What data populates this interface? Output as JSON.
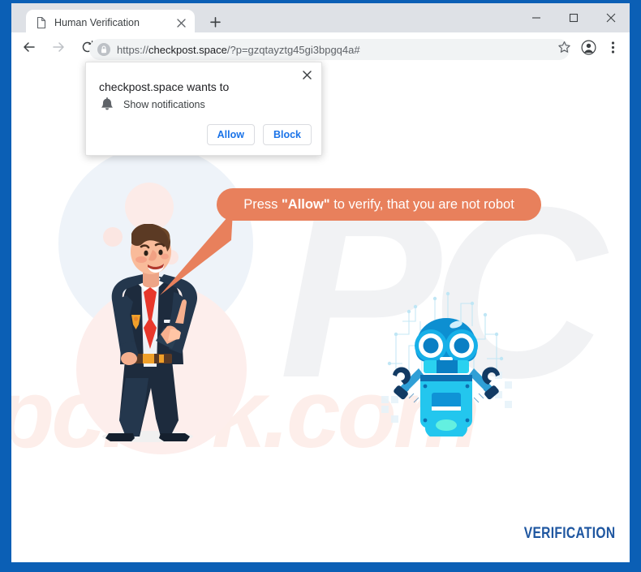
{
  "browser": {
    "tab": {
      "title": "Human Verification",
      "favicon_icon": "page-icon",
      "close_icon": "close-icon"
    },
    "new_tab_icon": "plus-icon",
    "window_controls": {
      "minimize_icon": "minimize-icon",
      "maximize_icon": "maximize-icon",
      "close_icon": "close-icon"
    },
    "toolbar": {
      "back_icon": "back-arrow-icon",
      "forward_icon": "forward-arrow-icon",
      "reload_icon": "reload-icon",
      "lock_icon": "lock-icon",
      "bookmark_icon": "star-icon",
      "profile_icon": "account-avatar-icon",
      "menu_icon": "three-dot-menu-icon",
      "url_scheme": "https://",
      "url_domain": "checkpost.space",
      "url_path": "/?p=gzqtayztg45gi3bpgq4a#",
      "url_full": "https://checkpost.space/?p=gzqtayztg45gi3bpgq4a#"
    }
  },
  "dialog": {
    "title": "checkpost.space wants to",
    "permission_label": "Show notifications",
    "permission_icon": "bell-icon",
    "close_icon": "close-icon",
    "allow_label": "Allow",
    "block_label": "Block",
    "accent_color": "#1a73e8"
  },
  "page": {
    "bubble_prefix": "Press ",
    "bubble_bold": "\"Allow\"",
    "bubble_suffix": " to verify, that you are not robot",
    "bubble_color": "#e8805c",
    "verification_label": "VERIFICATION",
    "verification_color": "#1e56a0",
    "watermark_logo": "PC",
    "watermark_site": "pcrisk.com",
    "man_illustration": "man-pointing-illustration",
    "robot_illustration": "robot-illustration"
  }
}
